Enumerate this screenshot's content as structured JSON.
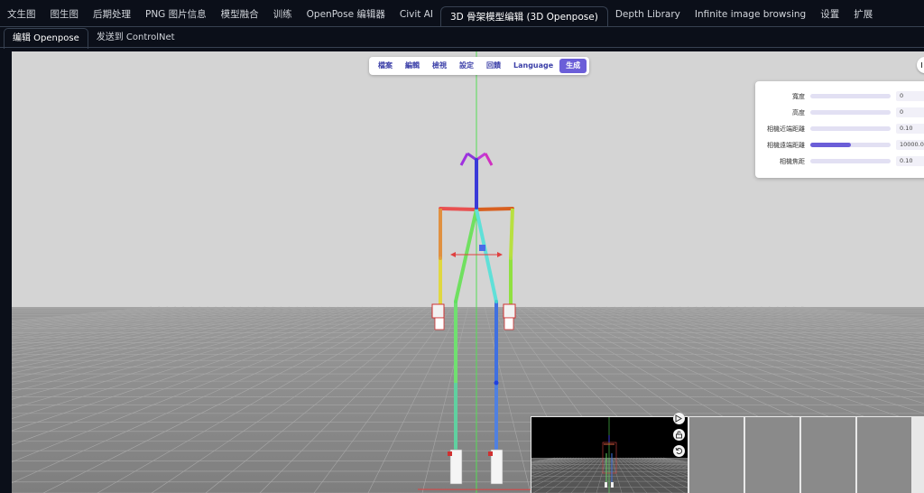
{
  "top_tabs": [
    "文生图",
    "图生图",
    "后期处理",
    "PNG 图片信息",
    "模型融合",
    "训练",
    "OpenPose 编辑器",
    "Civit AI",
    "3D 骨架模型编辑 (3D Openpose)",
    "Depth Library",
    "Infinite image browsing",
    "设置",
    "扩展"
  ],
  "active_top_tab_index": 8,
  "sub_tabs": [
    "编辑 Openpose",
    "发送到 ControlNet"
  ],
  "active_sub_tab_index": 0,
  "menu": {
    "file": "檔案",
    "edit": "編輯",
    "view": "檢視",
    "settings": "設定",
    "feedback": "回饋",
    "language": "Language",
    "generate": "生成"
  },
  "panel": {
    "rows": [
      {
        "label": "寬度",
        "value": "0",
        "fill": 0
      },
      {
        "label": "高度",
        "value": "0",
        "fill": 0
      },
      {
        "label": "相機近端距離",
        "value": "0.10",
        "fill": 0
      },
      {
        "label": "相機遠端距離",
        "value": "10000.00",
        "fill": 0.5
      },
      {
        "label": "相機焦距",
        "value": "0.10",
        "fill": 0
      }
    ]
  },
  "colors": {
    "accent": "#6b5ed8",
    "page_bg": "#0b0f19",
    "scene_bg": "#d4d4d4",
    "floor": "#8c8c8c",
    "axis_green": "#55dd55"
  },
  "icons": [
    "screenshot-icon",
    "lock-icon",
    "undo-icon"
  ]
}
